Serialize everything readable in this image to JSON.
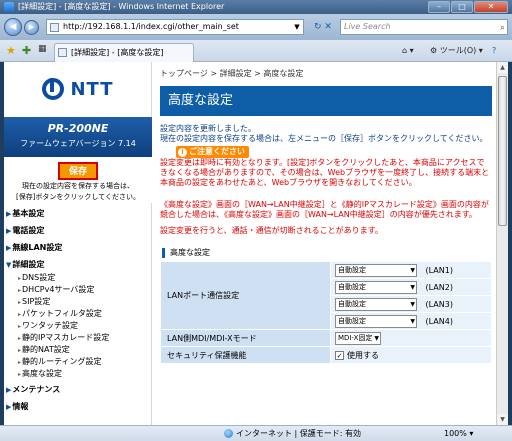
{
  "window": {
    "title": "[詳細設定] - [高度な設定] - Windows Internet Explorer",
    "btn_min": "–",
    "btn_max": "□",
    "btn_close": "✕"
  },
  "browser": {
    "back": "◀",
    "forward": "▶",
    "url": "http://192.168.1.1/index.cgi/other_main_set",
    "refresh": "↻ ✕",
    "search_placeholder": "Live Search",
    "tab_title": "[詳細設定] - [高度な設定]",
    "home_label": "⌂ ▾",
    "tools_label": "⚙ ツール(O) ▾",
    "status_zone": "インターネット | 保護モード: 有効",
    "zoom": "100% ▾"
  },
  "sidebar": {
    "logo_text": "NTT",
    "model": "PR-200NE",
    "firmware": "ファームウェアバージョン 7.14",
    "save_label": "保存",
    "save_note_1": "現在の設定内容を保存する場合は、",
    "save_note_2": "[保存]ボタンをクリックしてください。",
    "menu": [
      {
        "label": "基本設定"
      },
      {
        "label": "電話設定"
      },
      {
        "label": "無線LAN設定"
      },
      {
        "label": "詳細設定"
      }
    ],
    "submenu": [
      "DNS設定",
      "DHCPv4サーバ設定",
      "SIP設定",
      "パケットフィルタ設定",
      "ワンタッチ設定",
      "静的IPマスカレード設定",
      "静的NAT設定",
      "静的ルーティング設定",
      "高度な設定"
    ],
    "menu_after": [
      {
        "label": "メンテナンス"
      },
      {
        "label": "情報"
      }
    ]
  },
  "main": {
    "breadcrumb": "トップページ > 詳細設定 > 高度な設定",
    "title": "高度な設定",
    "intro_1": "設定内容を更新しました。",
    "intro_2": "現在の設定内容を保存する場合は、左メニューの［保存］ボタンをクリックしてください。",
    "notice_badge": "ご注意ください",
    "notice_1": "設定変更は即時に有効となります。[設定]ボタンをクリックしたあと、本商品にアクセスできなくなる場合がありますので、その場合は、Webブラウザを一度終了し、接続する端末と本商品の設定をあわせたあと、Webブラウザを開きなおしてください。",
    "notice_2": "《高度な設定》画面の［WAN→LAN中継設定］と《静的IPマスカレード設定》画面の内容が競合した場合は、《高度な設定》画面の［WAN→LAN中継設定］の内容が優先されます。",
    "notice_3": "設定変更を行うと、通話・通信が切断されることがあります。",
    "section_title": "高度な設定",
    "lan_port_label": "LANポート通信設定",
    "lan_ports": [
      {
        "value": "自動設定",
        "port": "(LAN1)"
      },
      {
        "value": "自動設定",
        "port": "(LAN2)"
      },
      {
        "value": "自動設定",
        "port": "(LAN3)"
      },
      {
        "value": "自動設定",
        "port": "(LAN4)"
      }
    ],
    "mdi_label": "LAN側MDI/MDI-Xモード",
    "mdi_value": "MDI-X固定",
    "security_label": "セキュリティ保護機能",
    "security_value": "使用する",
    "security_checked": "✓"
  }
}
